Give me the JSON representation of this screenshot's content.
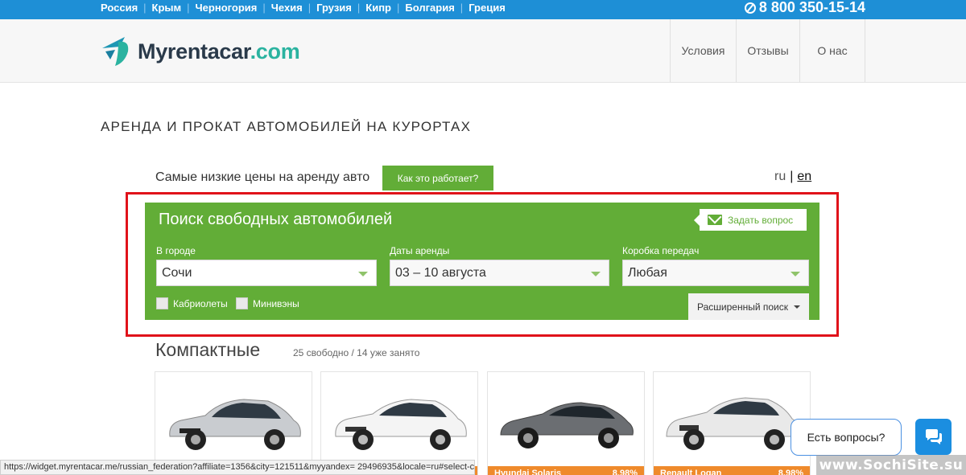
{
  "topbar": {
    "countries": [
      "Россия",
      "Крым",
      "Черногория",
      "Чехия",
      "Грузия",
      "Кипр",
      "Болгария",
      "Греция"
    ],
    "separator": "|",
    "phone": "8 800 350-15-14"
  },
  "header": {
    "logo_main": "Myrentacar",
    "logo_domain": ".com",
    "nav": [
      "Условия",
      "Отзывы",
      "О нас"
    ]
  },
  "page_title": "АРЕНДА И ПРОКАТ АВТОМОБИЛЕЙ НА КУРОРТАХ",
  "promo": {
    "tagline": "Самые низкие цены на аренду авто",
    "how_button": "Как это работает?",
    "lang_ru": "ru",
    "lang_sep": "|",
    "lang_en": "en"
  },
  "search": {
    "title": "Поиск свободных автомобилей",
    "ask_button": "Задать вопрос",
    "city_label": "В городе",
    "city_value": "Сочи",
    "dates_label": "Даты аренды",
    "dates_value": "03 – 10 августа",
    "gearbox_label": "Коробка передач",
    "gearbox_value": "Любая",
    "check_convertible": "Кабриолеты",
    "check_minivan": "Минивэны",
    "advanced_button": "Расширенный поиск"
  },
  "category": {
    "title": "Компактные",
    "count": "25 свободно / 14 уже занято"
  },
  "cars": [
    {
      "color": "#c9ccd0",
      "strip_name": "",
      "strip_pct": ""
    },
    {
      "color": "#f4f4f4",
      "strip_name": "",
      "strip_pct": ""
    },
    {
      "color": "#6b6e72",
      "strip_name": "Hyundai Solaris",
      "strip_pct": "8.98%"
    },
    {
      "color": "#e9e9e9",
      "strip_name": "Renault Logan",
      "strip_pct": "8.98%"
    }
  ],
  "chat": {
    "bubble_text": "Есть вопросы?",
    "icon": "chat-bubbles-icon"
  },
  "status_url": "https://widget.myrentacar.me/russian_federation?affiliate=1356&city=121511&myyandex= 29496935&locale=ru#select-city",
  "watermark": "www.SochiSite.su",
  "colors": {
    "topbar_blue": "#1e8fd6",
    "brand_green": "#62ad37",
    "highlight_red": "#e0121a",
    "strip_orange": "#ef8a2b"
  }
}
